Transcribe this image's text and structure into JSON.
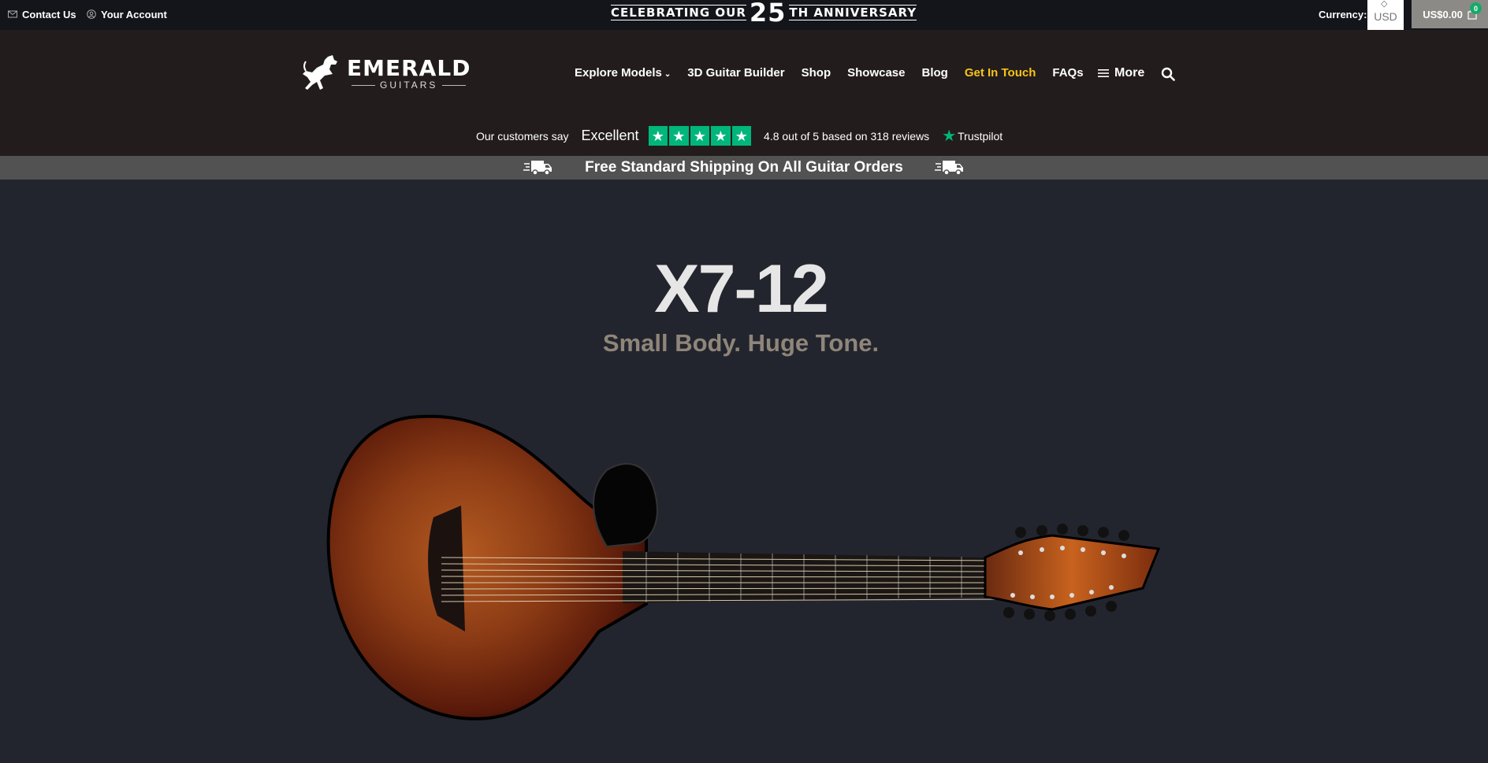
{
  "topbar": {
    "contact_label": "Contact Us",
    "account_label": "Your Account",
    "anniversary": {
      "before": "CELEBRATING OUR",
      "number": "25",
      "after": "TH ANNIVERSARY"
    },
    "currency_label": "Currency:",
    "currency_value": "USD",
    "cart_total": "US$0.00",
    "cart_count": "0"
  },
  "header": {
    "logo": {
      "main": "EMERALD",
      "sub": "GUITARS"
    },
    "nav": [
      {
        "label": "Explore Models"
      },
      {
        "label": "3D Guitar Builder"
      },
      {
        "label": "Shop"
      },
      {
        "label": "Showcase"
      },
      {
        "label": "Blog"
      },
      {
        "label": "Get In Touch"
      },
      {
        "label": "FAQs"
      }
    ],
    "more_label": "More"
  },
  "trustpilot": {
    "say": "Our customers say",
    "excellent": "Excellent",
    "stars": 5,
    "rating_text": "4.8 out of 5 based on 318 reviews",
    "brand": "Trustpilot"
  },
  "shipping": {
    "text": "Free Standard Shipping On All Guitar Orders"
  },
  "hero": {
    "title": "X7-12",
    "subtitle": "Small Body. Huge Tone."
  },
  "colors": {
    "accent": "#f5c518",
    "trustpilot": "#00b67a",
    "page_bg": "#23252e",
    "header_bg": "#231c1c"
  }
}
